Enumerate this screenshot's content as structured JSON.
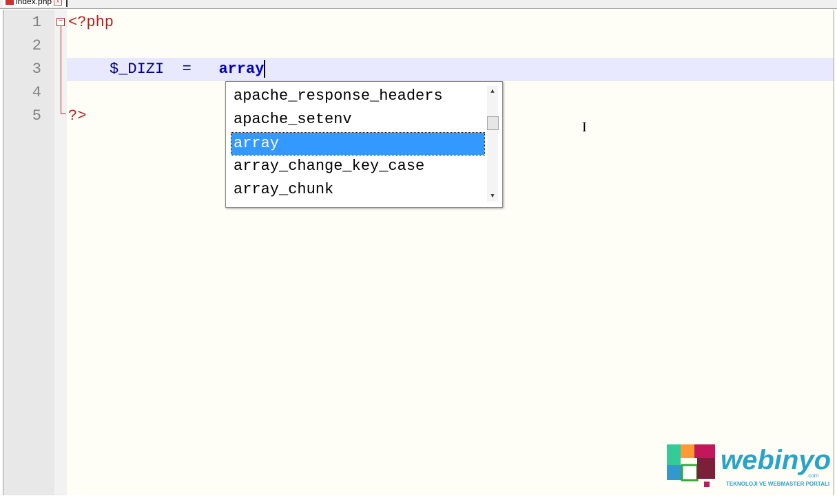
{
  "tab": {
    "filename": "index.php",
    "close": "x"
  },
  "editor": {
    "lines": [
      {
        "num": "1",
        "code": "<?php"
      },
      {
        "num": "2",
        "code": ""
      },
      {
        "num": "3",
        "var": "$_DIZI",
        "op": "=",
        "kw": "array"
      },
      {
        "num": "4",
        "code": ""
      },
      {
        "num": "5",
        "code": "?>"
      }
    ],
    "fold_marker": "−"
  },
  "autocomplete": {
    "items": [
      "apache_response_headers",
      "apache_setenv",
      "array",
      "array_change_key_case",
      "array_chunk"
    ],
    "selected_index": 2,
    "up": "▲",
    "down": "▼"
  },
  "logo": {
    "name": "webinyo",
    "domain": ".com",
    "tagline": "Teknoloji ve WebMaster Portalı"
  },
  "colors": {
    "selection": "#3399ff",
    "php_tag": "#b22222",
    "keyword": "#0000c0"
  }
}
